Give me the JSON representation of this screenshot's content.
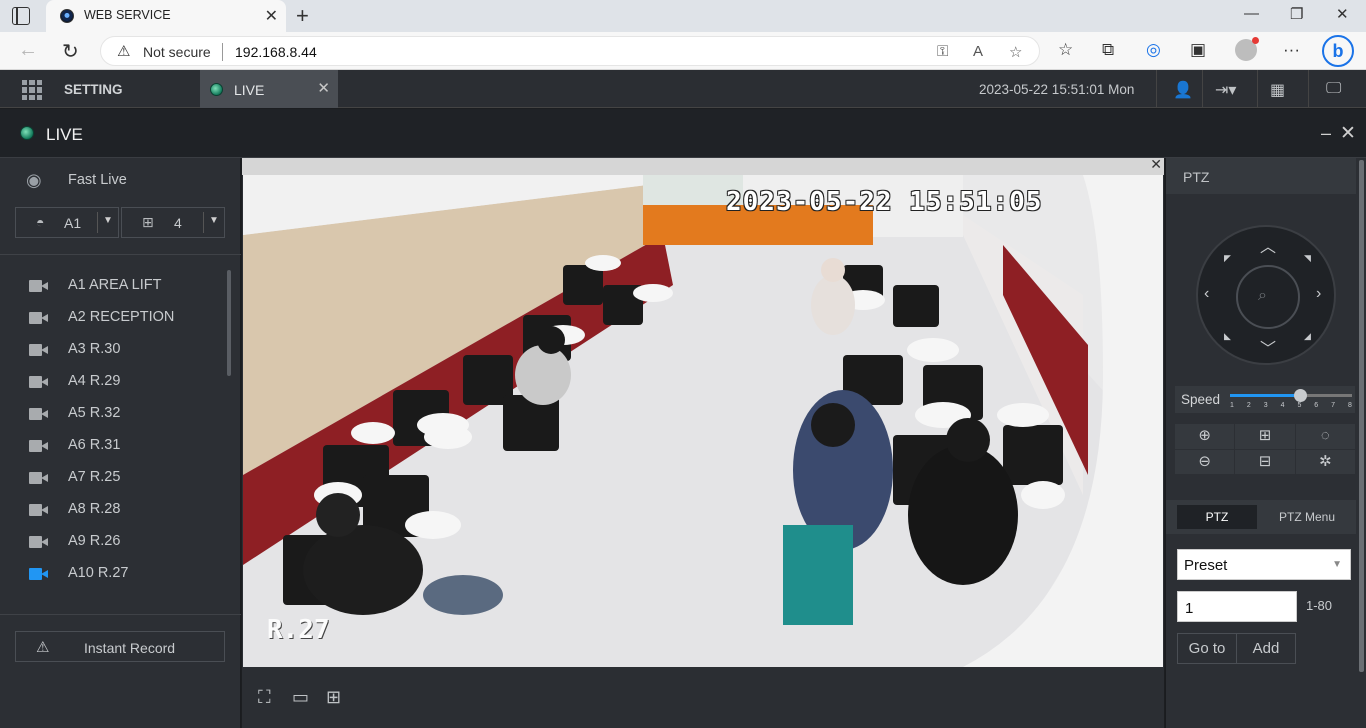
{
  "browser": {
    "tab_title": "WEB SERVICE",
    "not_secure": "Not secure",
    "url": "192.168.8.44"
  },
  "app": {
    "setting_label": "SETTING",
    "live_tab_label": "LIVE",
    "datetime": "2023-05-22 15:51:01 Mon"
  },
  "live": {
    "title": "LIVE"
  },
  "left_panel": {
    "fast_live": "Fast Live",
    "channel_select": "A1",
    "split_select": "4",
    "cameras": [
      {
        "label": "A1 AREA LIFT",
        "active": false
      },
      {
        "label": "A2 RECEPTION",
        "active": false
      },
      {
        "label": "A3 R.30",
        "active": false
      },
      {
        "label": "A4 R.29",
        "active": false
      },
      {
        "label": "A5 R.32",
        "active": false
      },
      {
        "label": "A6 R.31",
        "active": false
      },
      {
        "label": "A7 R.25",
        "active": false
      },
      {
        "label": "A8 R.28",
        "active": false
      },
      {
        "label": "A9 R.26",
        "active": false
      },
      {
        "label": "A10 R.27",
        "active": true
      }
    ],
    "instant_record": "Instant Record"
  },
  "video": {
    "osd_time": "2023-05-22 15:51:05",
    "osd_name": "R.27"
  },
  "ptz": {
    "header": "PTZ",
    "speed_label": "Speed",
    "speed_ticks": [
      "1",
      "2",
      "3",
      "4",
      "5",
      "6",
      "7",
      "8"
    ],
    "speed_value": 5,
    "tab_ptz": "PTZ",
    "tab_ptz_menu": "PTZ Menu",
    "preset_select": "Preset",
    "preset_number": "1",
    "preset_range": "1-80",
    "goto_label": "Go to",
    "add_label": "Add"
  },
  "colors": {
    "accent": "#2196f3",
    "panel": "#2c2f34",
    "header": "#2b2e33"
  }
}
